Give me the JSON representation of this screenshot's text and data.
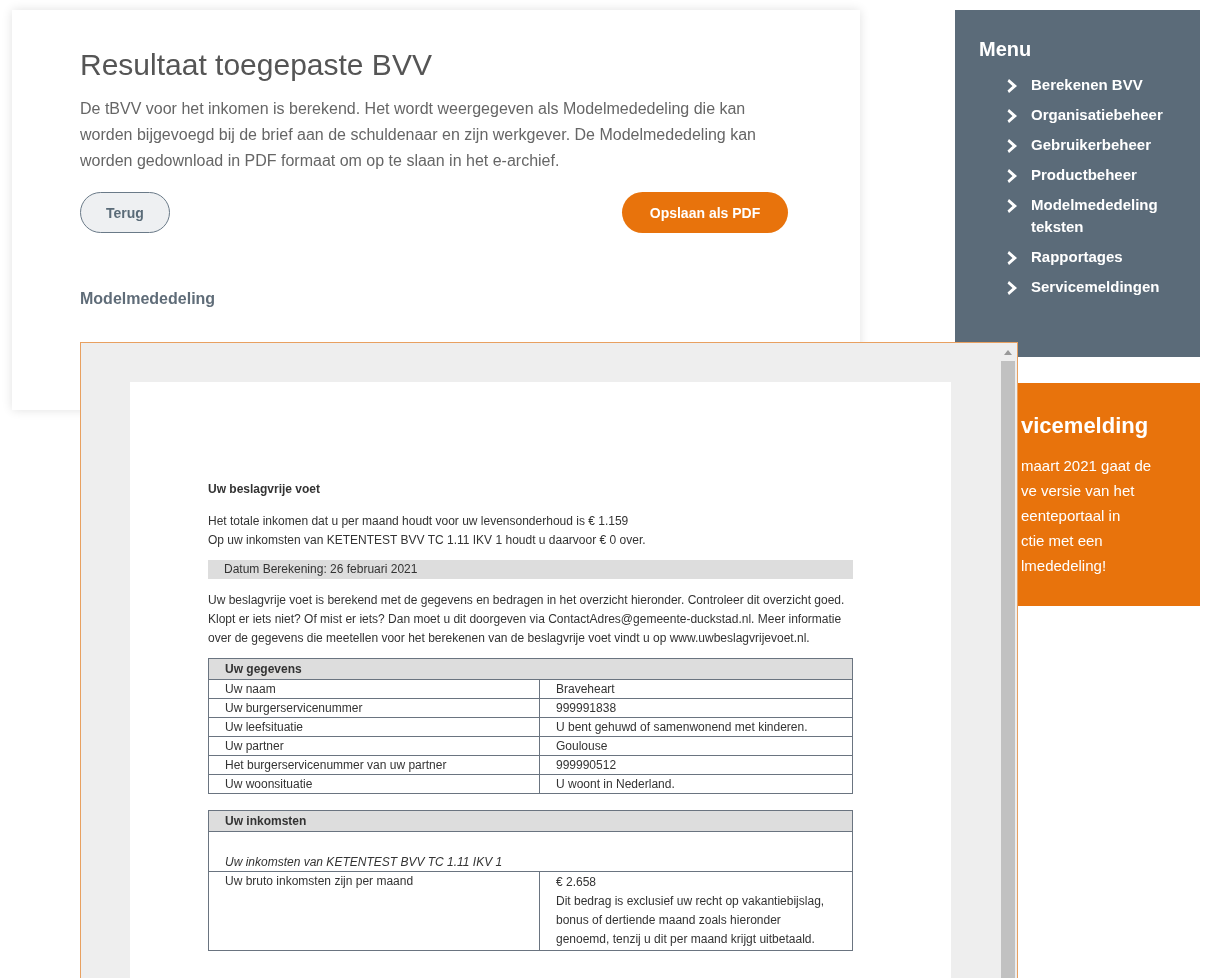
{
  "main": {
    "title": "Resultaat toegepaste BVV",
    "intro": "De tBVV voor het inkomen is berekend. Het wordt weergegeven als Modelmededeling die kan worden bijgevoegd bij de brief aan de schuldenaar en zijn werkgever. De Modelmededeling kan worden gedownload in PDF formaat om op te slaan in het e-archief.",
    "buttons": [
      {
        "label": "Terug",
        "kind": "secondary"
      },
      {
        "label": "Opslaan als PDF",
        "kind": "primary"
      }
    ],
    "section_label": "Modelmededeling"
  },
  "menu": {
    "title": "Menu",
    "items": [
      "Berekenen BVV",
      "Organisatiebeheer",
      "Gebruikerbeheer",
      "Productbeheer",
      "Modelmededeling teksten",
      "Rapportages",
      "Servicemeldingen"
    ]
  },
  "service_notice": {
    "title": "vicemelding",
    "lines": [
      "maart 2021 gaat de",
      "ve versie van het",
      "eenteportaal in",
      "ctie met een",
      "lmededeling!"
    ]
  },
  "document": {
    "heading": "Uw beslagvrije voet",
    "summary": [
      "Het totale inkomen dat u per maand houdt voor uw levensonderhoud is € 1.159",
      "Op uw inkomsten van KETENTEST BVV TC 1.11 IKV 1 houdt u daarvoor € 0 over."
    ],
    "date": "Datum Berekening: 26 februari 2021",
    "explanation": "Uw beslagvrije voet is berekend met de gegevens en bedragen in het overzicht hieronder. Controleer dit overzicht goed. Klopt er iets niet? Of mist er iets? Dan moet u dit doorgeven via ContactAdres@gemeente-duckstad.nl. Meer informatie over de gegevens die meetellen voor het berekenen van de beslagvrije voet vindt u op www.uwbeslagvrijevoet.nl.",
    "personal_table": {
      "title": "Uw gegevens",
      "rows": [
        {
          "label": "Uw naam",
          "value": "Braveheart"
        },
        {
          "label": "Uw burgerservicenummer",
          "value": "999991838"
        },
        {
          "label": "Uw leefsituatie",
          "value": "U bent gehuwd of samenwonend met kinderen."
        },
        {
          "label": "Uw partner",
          "value": "Goulouse"
        },
        {
          "label": "Het burgerservicenummer van uw partner",
          "value": "999990512"
        },
        {
          "label": "Uw woonsituatie",
          "value": "U woont in Nederland."
        }
      ]
    },
    "income_table": {
      "title": "Uw inkomsten",
      "subtitle": "Uw inkomsten van KETENTEST BVV TC 1.11 IKV 1",
      "rows": [
        {
          "label": "Uw bruto inkomsten zijn per maand",
          "value": "€ 2.658",
          "note": "Dit bedrag is exclusief uw recht op vakantiebijslag, bonus of dertiende maand zoals hieronder genoemd, tenzij u dit per maand krijgt uitbetaald."
        }
      ]
    }
  }
}
